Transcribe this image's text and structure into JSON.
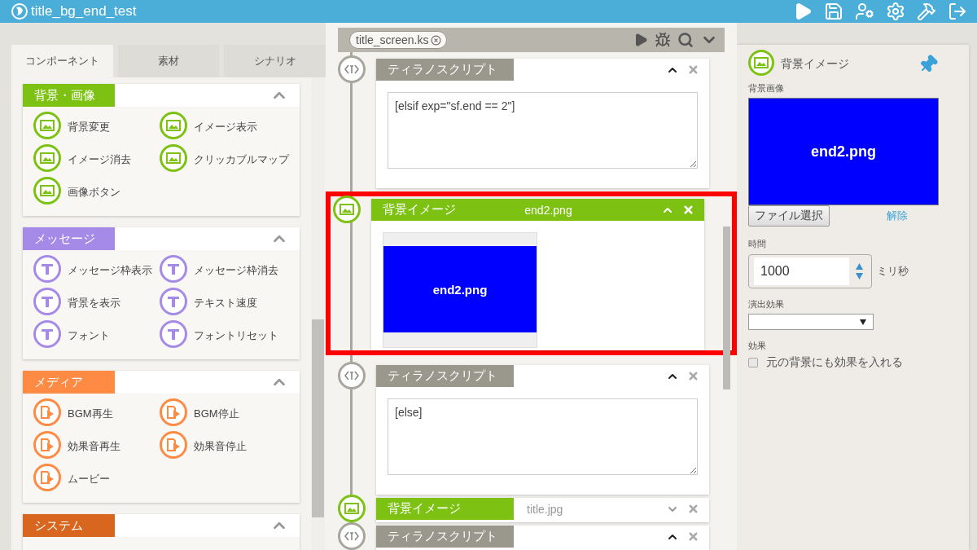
{
  "app": {
    "title": "title_bg_end_test"
  },
  "left_panel": {
    "tabs": [
      {
        "label": "コンポーネント",
        "selected": true
      },
      {
        "label": "素材",
        "selected": false
      },
      {
        "label": "シナリオ",
        "selected": false
      }
    ],
    "sections": [
      {
        "title": "背景・画像",
        "kind": "image",
        "color": "#7dc212",
        "expanded": true,
        "items": [
          "背景変更",
          "イメージ表示",
          "イメージ消去",
          "クリッカブルマップ",
          "画像ボタン"
        ]
      },
      {
        "title": "メッセージ",
        "kind": "message",
        "color": "#a58ae8",
        "expanded": true,
        "items": [
          "メッセージ枠表示",
          "メッセージ枠消去",
          "背景を表示",
          "テキスト速度",
          "フォント",
          "フォントリセット"
        ]
      },
      {
        "title": "メディア",
        "kind": "media",
        "color": "#ff8a43",
        "expanded": true,
        "items": [
          "BGM再生",
          "BGM停止",
          "効果音再生",
          "効果音停止",
          "ムービー"
        ]
      },
      {
        "title": "システム",
        "kind": "system",
        "color": "#d8661e",
        "expanded": true
      }
    ]
  },
  "editor": {
    "file_tab": "title_screen.ks",
    "blocks": [
      {
        "kind": "script",
        "title": "ティラノスクリプト",
        "expanded": true,
        "selected": false,
        "code": "[elsif exp=\"sf.end == 2\"]"
      },
      {
        "kind": "image",
        "title": "背景イメージ",
        "value": "end2.png",
        "expanded": true,
        "selected": true,
        "preview": "end2.png"
      },
      {
        "kind": "script",
        "title": "ティラノスクリプト",
        "expanded": true,
        "selected": false,
        "code": "[else]"
      },
      {
        "kind": "image",
        "title": "背景イメージ",
        "value": "title.jpg",
        "expanded": false,
        "selected": false
      },
      {
        "kind": "script",
        "title": "ティラノスクリプト",
        "expanded": true,
        "selected": false
      }
    ]
  },
  "properties": {
    "title": "背景イメージ",
    "image_label": "背景画像",
    "image_preview": "end2.png",
    "file_button": "ファイル選択",
    "clear_link": "解除",
    "time_label": "時間",
    "time_value": "1000",
    "time_unit": "ミリ秒",
    "effect_label": "演出効果",
    "extra_label": "効果",
    "checkbox": {
      "label": "元の背景にも効果を入れる",
      "checked": false
    }
  }
}
